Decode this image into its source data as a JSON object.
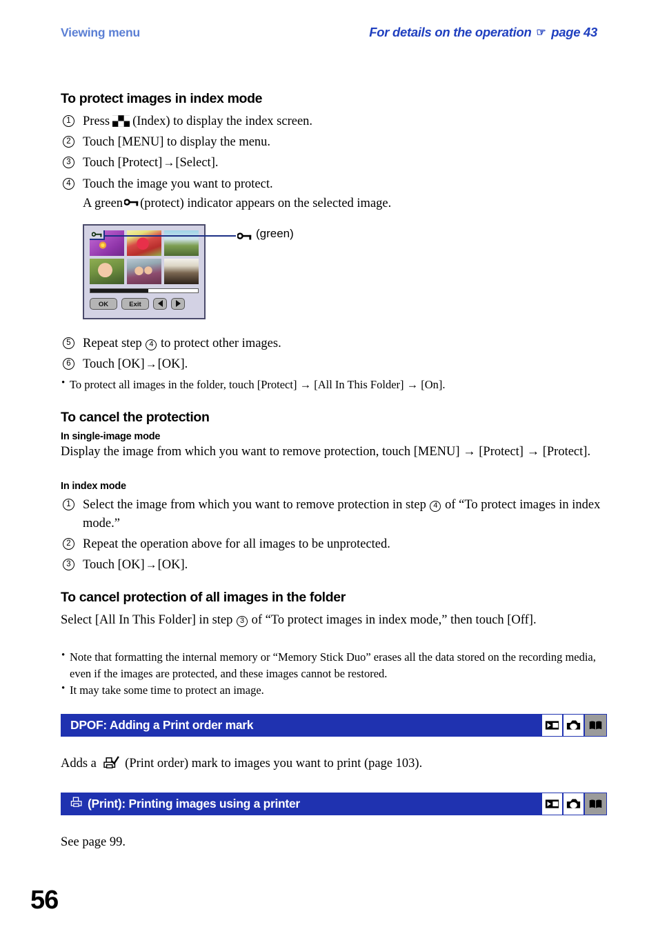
{
  "running_head": {
    "left": "Viewing menu",
    "right_prefix": "For details on the operation",
    "right_hand_icon": "pointing-hand-icon",
    "right_suffix": "page 43"
  },
  "colors": {
    "header_left": "#5b7fd4",
    "header_right": "#1f3fbf",
    "bar_blue": "#1f32b0",
    "callout_navy": "#1c2f86",
    "screen_bg": "#d3d2e4",
    "mode_off_gray": "#9b9b9b"
  },
  "sections": {
    "protect_index": {
      "heading": "To protect images in index mode",
      "steps": [
        {
          "num": "1",
          "pre": "Press",
          "icon": "index-icon",
          "post": "(Index) to display the index screen."
        },
        {
          "num": "2",
          "text": "Touch [MENU] to display the menu."
        },
        {
          "num": "3",
          "a": "Touch [Protect]",
          "arrow": "→",
          "b": "[Select]."
        },
        {
          "num": "4",
          "line1": "Touch the image you want to protect.",
          "line2a": "A green",
          "line2icon": "key-protect-icon",
          "line2b": "(protect) indicator appears on the selected image."
        }
      ],
      "figure": {
        "callout_icon": "key-protect-icon",
        "callout_label": "(green)",
        "badge_icon": "key-protect-icon",
        "buttons": {
          "ok": "OK",
          "exit": "Exit",
          "prev": "left-arrow-icon",
          "next": "right-arrow-icon"
        },
        "thumbnails": [
          "purple-flower-thumbnail",
          "red-flower-thumbnail",
          "tree-sky-thumbnail",
          "woman-portrait-thumbnail",
          "two-girls-thumbnail",
          "blossom-tree-thumbnail"
        ]
      },
      "steps_after": [
        {
          "num": "5",
          "a": "Repeat step",
          "ref": "4",
          "b": "to protect other images."
        },
        {
          "num": "6",
          "a": "Touch [OK]",
          "arrow": "→",
          "b": "[OK]."
        }
      ],
      "bullet": "To protect all images in the folder, touch [Protect] → [All In This Folder] → [On]."
    },
    "cancel_protection": {
      "heading": "To cancel the protection",
      "single_image": {
        "subheading": "In single-image mode",
        "body": "Display the image from which you want to remove protection, touch [MENU] → [Protect] → [Protect]."
      },
      "index_mode": {
        "subheading": "In index mode",
        "steps": [
          {
            "num": "1",
            "a": "Select the image from which you want to remove protection in step",
            "ref": "4",
            "b": "of “To protect images in index mode.”"
          },
          {
            "num": "2",
            "text": "Repeat the operation above for all images to be unprotected."
          },
          {
            "num": "3",
            "a": "Touch [OK]",
            "arrow": "→",
            "b": "[OK]."
          }
        ]
      }
    },
    "cancel_all": {
      "heading": "To cancel protection of all images in the folder",
      "a": "Select [All In This Folder] in step",
      "ref": "3",
      "b": "of “To protect images in index mode,” then touch [Off].",
      "bullets": [
        "Note that formatting the internal memory or “Memory Stick Duo” erases all the data stored on the recording media, even if the images are protected, and these images cannot be restored.",
        "It may take some time to protect an image."
      ]
    },
    "dpof": {
      "bar_title": "DPOF: Adding a Print order mark",
      "mode_icons": [
        {
          "name": "playback-mode-icon",
          "state": "on"
        },
        {
          "name": "camera-mode-icon",
          "state": "on"
        },
        {
          "name": "book-mode-icon",
          "state": "off"
        }
      ],
      "body_a": "Adds a",
      "body_icon": "print-order-mark-icon",
      "body_b": "(Print order) mark to images you want to print (page 103)."
    },
    "print": {
      "bar_icon": "printer-icon",
      "bar_title": "(Print): Printing images using a printer",
      "mode_icons": [
        {
          "name": "playback-mode-icon",
          "state": "on"
        },
        {
          "name": "camera-mode-icon",
          "state": "on"
        },
        {
          "name": "book-mode-icon",
          "state": "off"
        }
      ],
      "body": "See page 99."
    }
  },
  "folio": "56"
}
